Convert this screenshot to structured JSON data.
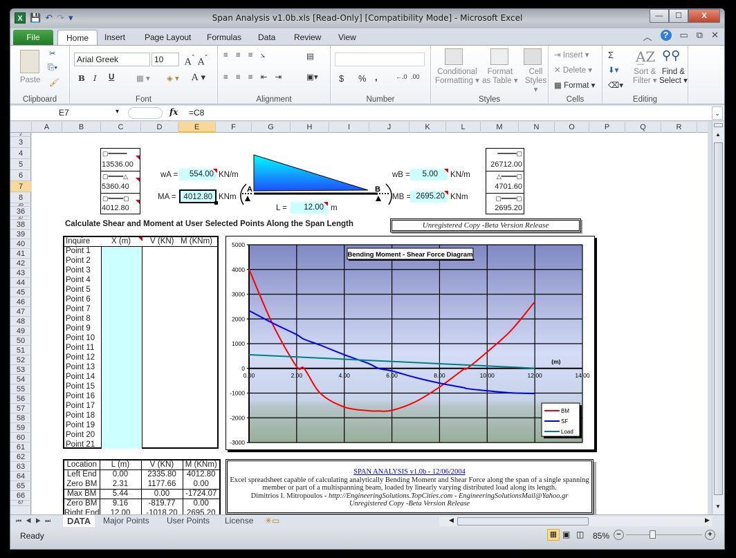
{
  "window": {
    "title": "Span Analysis v1.0b.xls  [Read-Only]  [Compatibility Mode]  -  Microsoft Excel",
    "buttons": {
      "minimize": "—",
      "maximize": "☐",
      "close": "X"
    }
  },
  "ribbon_tabs": [
    "File",
    "Home",
    "Insert",
    "Page Layout",
    "Formulas",
    "Data",
    "Review",
    "View"
  ],
  "active_tab": "Home",
  "ribbon": {
    "clipboard": {
      "label": "Clipboard",
      "paste": "Paste"
    },
    "font": {
      "label": "Font",
      "font_name": "Arial Greek",
      "font_size": "10",
      "bold": "B",
      "italic": "I",
      "underline": "U"
    },
    "alignment": {
      "label": "Alignment"
    },
    "number": {
      "label": "Number",
      "format": "",
      "currency": "$",
      "percent": "%",
      "comma": ",",
      "inc_dec": "←.0 .00",
      "dec_dec": ".00 →.0"
    },
    "styles": {
      "label": "Styles",
      "conditional": "Conditional",
      "conditional2": "Formatting",
      "format_table": "Format",
      "format_table2": "as Table",
      "cell_styles": "Cell",
      "cell_styles2": "Styles"
    },
    "cells": {
      "label": "Cells",
      "insert": "Insert",
      "delete": "Delete",
      "format": "Format"
    },
    "editing": {
      "label": "Editing",
      "sum": "Σ",
      "sort": "Sort &",
      "sort2": "Filter",
      "find": "Find &",
      "find2": "Select"
    }
  },
  "formula_bar": {
    "name_box": "E7",
    "fx": "fx",
    "formula": "=C8"
  },
  "columns": [
    "A",
    "B",
    "C",
    "D",
    "E",
    "F",
    "G",
    "H",
    "I",
    "J",
    "K",
    "L",
    "M",
    "N",
    "O",
    "P",
    "Q",
    "R"
  ],
  "selected_column": "E",
  "rows": [
    "2",
    "3",
    "4",
    "5",
    "6",
    "7",
    "8",
    "35",
    "36",
    "37",
    "38",
    "39",
    "40",
    "41",
    "42",
    "43",
    "44",
    "45",
    "46",
    "47",
    "48",
    "49",
    "50",
    "51",
    "52",
    "53",
    "54",
    "55",
    "56",
    "57",
    "58",
    "59",
    "60",
    "61",
    "62",
    "63",
    "64",
    "65",
    "66",
    "67"
  ],
  "selected_row": "7",
  "beam": {
    "left_reactions": [
      "13536.00",
      "5360.40",
      "4012.80"
    ],
    "right_reactions": [
      "26712.00",
      "4701.60",
      "2695.20"
    ],
    "wa_label": "wA =",
    "wa_value": "554.00",
    "wa_unit": "KN/m",
    "ma_label": "MA =",
    "ma_value": "4012.80",
    "ma_unit": "KNm",
    "wb_label": "wB =",
    "wb_value": "5.00",
    "wb_unit": "KN/m",
    "mb_label": "MB =",
    "mb_value": "2695.20",
    "mb_unit": "KNm",
    "l_label": "L =",
    "l_value": "12.00",
    "l_unit": "m",
    "point_a": "A",
    "point_b": "B"
  },
  "section_title": "Calculate Shear and Moment at User Selected Points Along the Span Length",
  "unregistered_banner": "Unregistered Copy -Beta Version Release",
  "inquire_table": {
    "headers": [
      "Inquire",
      "X (m)",
      "V (KN)",
      "M (KNm)"
    ],
    "points": [
      "Point 1",
      "Point 2",
      "Point 3",
      "Point 4",
      "Point 5",
      "Point 6",
      "Point 7",
      "Point 8",
      "Point 9",
      "Point 10",
      "Point 11",
      "Point 12",
      "Point 13",
      "Point 14",
      "Point 15",
      "Point 16",
      "Point 17",
      "Point 18",
      "Point 19",
      "Point 20",
      "Point 21"
    ]
  },
  "results_table": {
    "headers": [
      "Location",
      "L (m)",
      "V (KN)",
      "M (KNm)"
    ],
    "rows": [
      [
        "Left End",
        "0.00",
        "2335.80",
        "4012.80"
      ],
      [
        "Zero BM",
        "2.31",
        "1177.66",
        "0.00"
      ],
      [
        "Max BM",
        "5.44",
        "0.00",
        "-1724.07"
      ],
      [
        "Zero BM",
        "9.16",
        "-819.77",
        "0.00"
      ],
      [
        "Right End",
        "12.00",
        "-1018.20",
        "2695.20"
      ]
    ]
  },
  "info_box": {
    "title": "SPAN ANALYSIS  v1.0b  -  12/06/2004",
    "line1": "Excel spreadsheet capable of calculating analytically Bending Moment and Shear Force along the span of a single spanning",
    "line2": "member or part of a multispanning beam, loaded by linearly varying distributed load along its length.",
    "line3a": "Dimitrios I. Mitropoulos - ",
    "line3b": "http://EngineeringSolutions.TopCities.com - EngineeringSolutionsMail@Yahoo.gr",
    "line4": "Unregistered  Copy -Beta Version Release"
  },
  "chart_data": {
    "type": "line",
    "title": "Bending Moment - Shear Force Diagram",
    "xlabel": "(m)",
    "ylabel": "",
    "xlim": [
      0,
      14
    ],
    "ylim": [
      -3000,
      5000
    ],
    "xticks": [
      "0.00",
      "2.00",
      "4.00",
      "6.00",
      "8.00",
      "10.00",
      "12.00",
      "14.00"
    ],
    "yticks": [
      "5000",
      "4000",
      "3000",
      "2000",
      "1000",
      "0",
      "-1000",
      "-2000",
      "-3000"
    ],
    "grid": true,
    "legend": "bottom-right",
    "x": [
      0,
      1,
      2,
      2.31,
      3,
      4,
      5,
      5.44,
      6,
      7,
      8,
      9,
      9.16,
      10,
      11,
      12
    ],
    "series": [
      {
        "name": "BM",
        "color": "#ff0000",
        "values": [
          4012.8,
          1773,
          72,
          0,
          -1013,
          -1563,
          -1714,
          -1724,
          -1700,
          -1346,
          -758,
          -47,
          0,
          663,
          1530,
          2695.2
        ]
      },
      {
        "name": "SF",
        "color": "#0000ff",
        "values": [
          2335.8,
          1828,
          1367,
          1177.66,
          937,
          552,
          205,
          0,
          -105,
          -374,
          -598,
          -776,
          -819.77,
          -907,
          -990,
          -1018.2
        ]
      },
      {
        "name": "Load",
        "color": "#008080",
        "values": [
          554,
          508,
          463,
          449,
          417,
          371,
          325,
          305,
          280,
          234,
          188,
          142,
          135,
          97,
          51,
          5
        ]
      }
    ]
  },
  "sheet_tabs": [
    "DATA",
    "Major Points",
    "User Points",
    "License"
  ],
  "active_sheet": "DATA",
  "status": {
    "mode": "Ready",
    "zoom": "85%"
  }
}
